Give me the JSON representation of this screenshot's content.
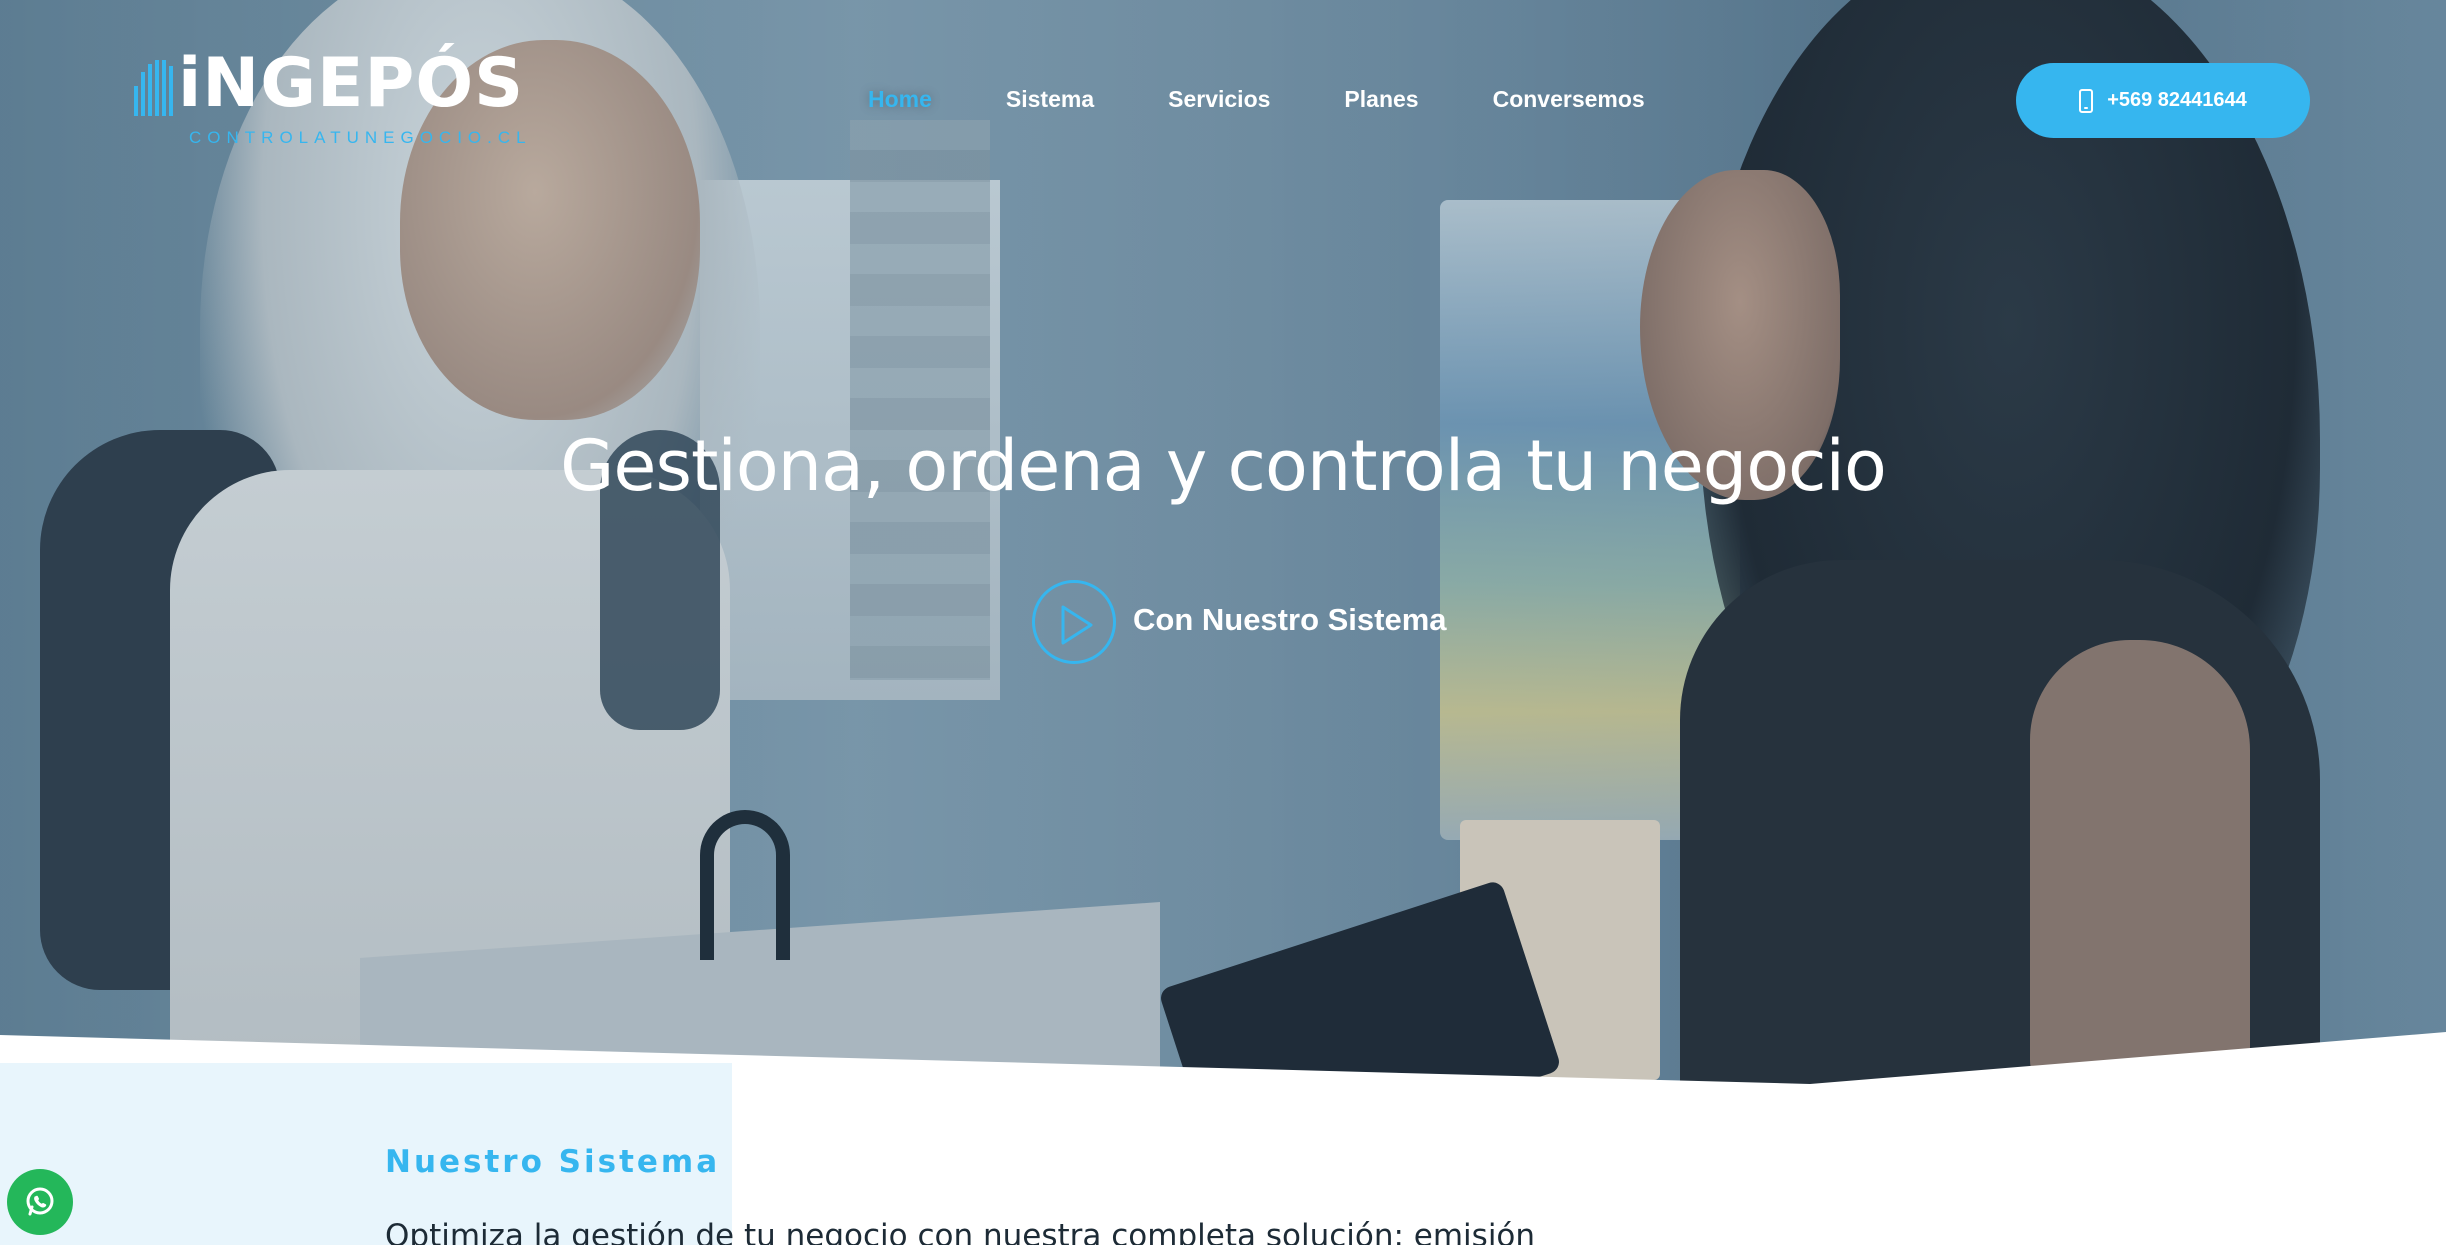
{
  "brand": {
    "name": "iNGEPÓS",
    "tagline": "CONTROLATUNEGOCIO.CL",
    "accent_color": "#36b6ef"
  },
  "nav": {
    "items": [
      {
        "label": "Home",
        "active": true
      },
      {
        "label": "Sistema",
        "active": false
      },
      {
        "label": "Servicios",
        "active": false
      },
      {
        "label": "Planes",
        "active": false
      },
      {
        "label": "Conversemos",
        "active": false
      }
    ]
  },
  "cta": {
    "icon": "phone-icon",
    "label": "+569 82441644"
  },
  "hero": {
    "title": "Gestiona, ordena y controla tu negocio",
    "play_icon": "play-icon",
    "play_label": "Con Nuestro Sistema"
  },
  "section": {
    "eyebrow": "Nuestro Sistema",
    "lead": "Optimiza la gestión de tu negocio con nuestra completa solución: emisión"
  },
  "whatsapp": {
    "icon": "whatsapp-icon",
    "color": "#24b75a"
  }
}
